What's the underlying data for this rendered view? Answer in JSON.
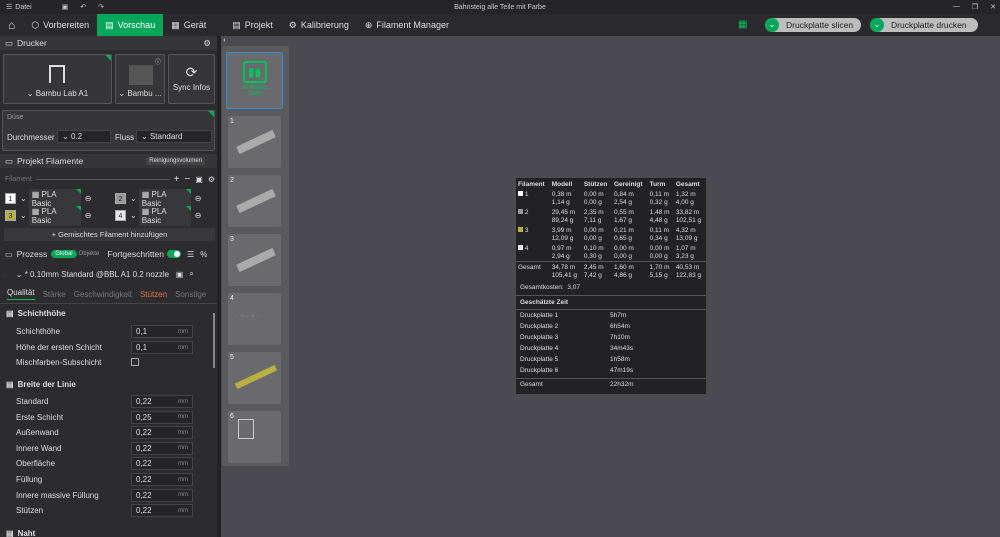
{
  "titlebar": {
    "menu": "Datei",
    "title": "Bahnsteig alle Teile mit Farbe"
  },
  "nav": {
    "tabs": [
      {
        "label": "Vorbereiten"
      },
      {
        "label": "Vorschau"
      },
      {
        "label": "Gerät"
      },
      {
        "label": "Projekt"
      },
      {
        "label": "Kalibrierung"
      },
      {
        "label": "Filament Manager"
      }
    ],
    "slice": "Druckplatte slicen",
    "print": "Druckplatte drucken"
  },
  "printer": {
    "header": "Drucker",
    "name": "Bambu Lab A1",
    "plate": "Bambu ...",
    "sync": "Sync Infos"
  },
  "nozzle": {
    "title": "Düse",
    "diam_label": "Durchmesser",
    "diam": "0.2",
    "flow_label": "Fluss",
    "flow": "Standard"
  },
  "filaments": {
    "header": "Projekt Filamente",
    "purge": "Reinigungsvolumen",
    "list_label": "Filament",
    "items": [
      {
        "num": "1",
        "name": "PLA Basic",
        "color": "#ffffff"
      },
      {
        "num": "2",
        "name": "PLA Basic",
        "color": "#9a9a9a"
      },
      {
        "num": "3",
        "name": "PLA Basic",
        "color": "#b8b040"
      },
      {
        "num": "4",
        "name": "PLA Basic",
        "color": "#e8e8e8"
      }
    ],
    "add_mixed": "+ Gemischtes Filament hinzufügen"
  },
  "process": {
    "label": "Prozess",
    "global": "Global",
    "object": "Objekte",
    "advanced": "Fortgeschritten",
    "profile": "* 0.10mm Standard @BBL A1 0.2 nozzle",
    "tabs": [
      "Qualität",
      "Stärke",
      "Geschwindigkeit",
      "Stützen",
      "Sonstige"
    ]
  },
  "quality": {
    "layer_section": "Schichthöhe",
    "layer_height": "Schichthöhe",
    "layer_height_val": "0,1",
    "first_layer": "Höhe der ersten Schicht",
    "first_layer_val": "0,1",
    "mix_sub": "Mischfarben-Subschicht",
    "width_section": "Breite der Linie",
    "unit": "mm",
    "widths": [
      {
        "label": "Standard",
        "val": "0,22"
      },
      {
        "label": "Erste Schicht",
        "val": "0,25"
      },
      {
        "label": "Außenwand",
        "val": "0,22"
      },
      {
        "label": "Innere Wand",
        "val": "0,22"
      },
      {
        "label": "Oberfläche",
        "val": "0,22"
      },
      {
        "label": "Füllung",
        "val": "0,22"
      },
      {
        "label": "Innere massive Füllung",
        "val": "0,22"
      },
      {
        "label": "Stützen",
        "val": "0,22"
      }
    ],
    "seam_section": "Naht"
  },
  "plates": [
    {
      "n": "1"
    },
    {
      "n": "2"
    },
    {
      "n": "3"
    },
    {
      "n": "4"
    },
    {
      "n": "5"
    },
    {
      "n": "6"
    }
  ],
  "allplates": "All Plates Stats",
  "stats": {
    "headers": [
      "Filament",
      "Modell",
      "Stützen",
      "Gereinigt",
      "Turm",
      "Gesamt"
    ],
    "rows": [
      {
        "f": "1",
        "color": "#ffffff",
        "m": "0,38 m\n1,14 g",
        "s": "0,00 m\n0,00 g",
        "g": "0,84 m\n2,54 g",
        "t": "0,11 m\n0,32 g",
        "tot": "1,32 m\n4,00 g"
      },
      {
        "f": "2",
        "color": "#9a9a9a",
        "m": "29,45 m\n89,24 g",
        "s": "2,35 m\n7,11 g",
        "g": "0,55 m\n1,67 g",
        "t": "1,48 m\n4,48 g",
        "tot": "33,82 m\n102,51 g"
      },
      {
        "f": "3",
        "color": "#b8b040",
        "m": "3,99 m\n12,09 g",
        "s": "0,00 m\n0,00 g",
        "g": "0,21 m\n0,65 g",
        "t": "0,11 m\n0,34 g",
        "tot": "4,32 m\n13,09 g"
      },
      {
        "f": "4",
        "color": "#e8e8e8",
        "m": "0,97 m\n2,94 g",
        "s": "0,10 m\n0,30 g",
        "g": "0,00 m\n0,00 g",
        "t": "0,00 m\n0,00 g",
        "tot": "1,07 m\n3,23 g"
      }
    ],
    "total": {
      "f": "Gesamt",
      "m": "34,78 m\n105,41 g",
      "s": "2,45 m\n7,42 g",
      "g": "1,60 m\n4,86 g",
      "t": "1,70 m\n5,15 g",
      "tot": "40,53 m\n122,83 g"
    },
    "cost_label": "Gesamtkosten:",
    "cost": "3,07",
    "time_header": "Geschätzte Zeit",
    "times": [
      {
        "p": "Druckplatte 1",
        "t": "5h7m"
      },
      {
        "p": "Druckplatte 2",
        "t": "6h54m"
      },
      {
        "p": "Druckplatte 3",
        "t": "7h10m"
      },
      {
        "p": "Druckplatte 4",
        "t": "34m43s"
      },
      {
        "p": "Druckplatte 5",
        "t": "1h58m"
      },
      {
        "p": "Druckplatte 6",
        "t": "47m19s"
      }
    ],
    "time_total_label": "Gesamt",
    "time_total": "22h32m"
  }
}
